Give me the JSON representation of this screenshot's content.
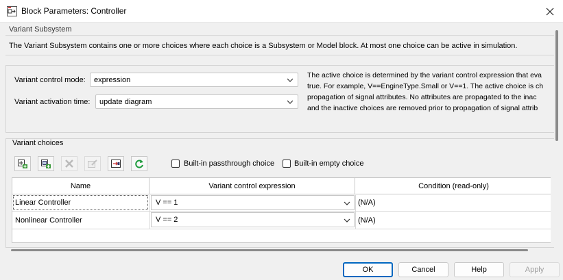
{
  "window": {
    "title": "Block Parameters: Controller"
  },
  "section": {
    "title": "Variant Subsystem",
    "description": "The Variant Subsystem contains one or more choices where each choice is a Subsystem or Model block. At most one choice can be active in simulation."
  },
  "params": {
    "control_mode_label": "Variant control mode:",
    "control_mode_value": "expression",
    "activation_time_label": "Variant activation time:",
    "activation_time_value": "update diagram",
    "help_lines": [
      "The active choice is determined by the variant control expression that eva",
      "true. For example, V==EngineType.Small or V==1. The active choice is ch",
      "propagation of signal attributes. No attributes are propagated to the inac",
      "and the inactive choices are removed prior to propagation of signal attrib"
    ]
  },
  "choices": {
    "title": "Variant choices",
    "toolbar_icons": [
      "add-subsystem-choice-icon",
      "add-model-choice-icon",
      "delete-choice-icon",
      "edit-choice-icon",
      "open-block-icon",
      "refresh-icon"
    ],
    "passthrough_label": "Built-in passthrough choice",
    "empty_label": "Built-in empty choice",
    "passthrough_checked": false,
    "empty_checked": false,
    "columns": [
      "Name",
      "Variant control expression",
      "Condition (read-only)"
    ],
    "rows": [
      {
        "name": "Linear Controller",
        "expression": "V == 1",
        "condition": "(N/A)"
      },
      {
        "name": "Nonlinear Controller",
        "expression": "V == 2",
        "condition": "(N/A)"
      }
    ]
  },
  "buttons": {
    "ok": "OK",
    "cancel": "Cancel",
    "help": "Help",
    "apply": "Apply"
  },
  "colors": {
    "accent": "#0067c0",
    "refresh_green": "#1a9a3a"
  }
}
